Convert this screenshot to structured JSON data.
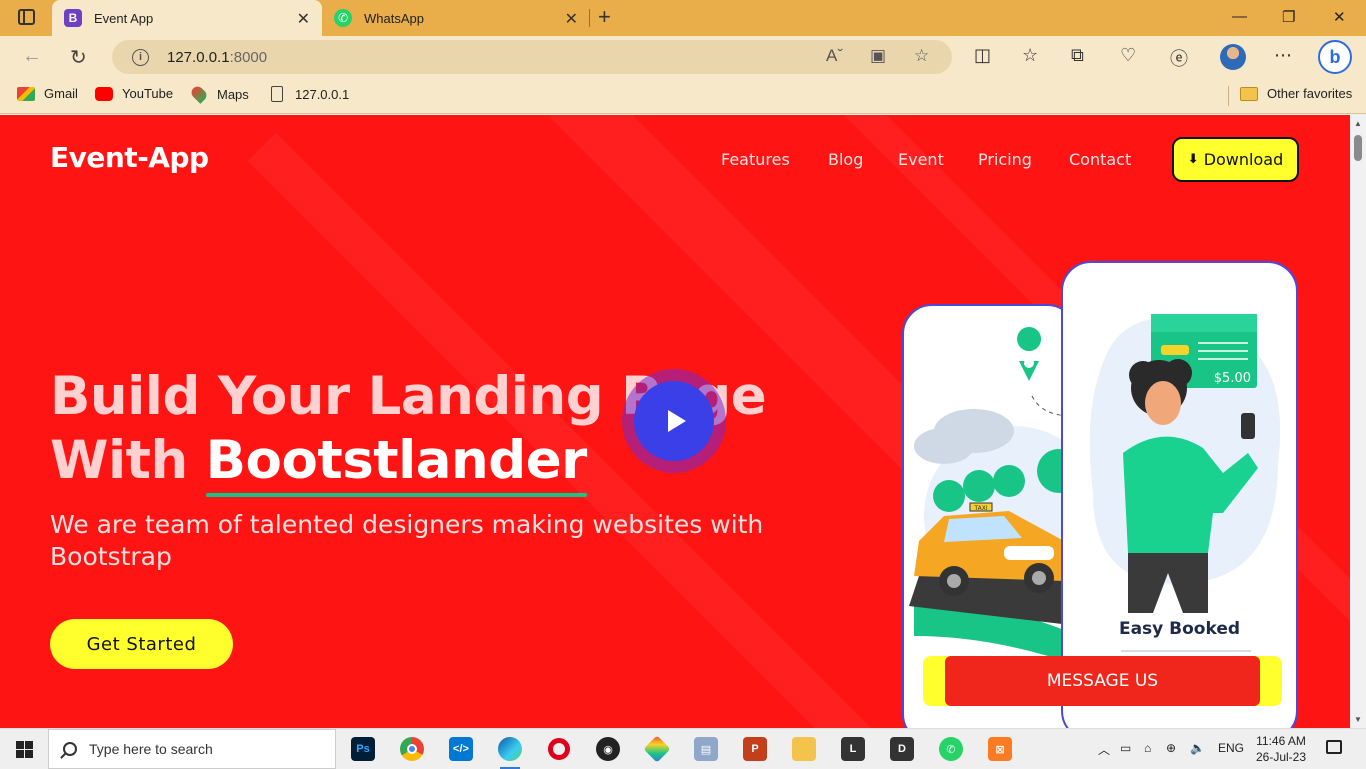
{
  "browser": {
    "tabs": [
      {
        "title": "Event App",
        "icon": "bootstrap-icon",
        "active": true
      },
      {
        "title": "WhatsApp",
        "icon": "whatsapp-icon",
        "active": false
      }
    ],
    "address": {
      "host": "127.0.0.1",
      "port": ":8000"
    },
    "bookmarks": [
      {
        "label": "Gmail",
        "icon": "gmail-icon"
      },
      {
        "label": "YouTube",
        "icon": "youtube-icon"
      },
      {
        "label": "Maps",
        "icon": "maps-icon"
      },
      {
        "label": "127.0.0.1",
        "icon": "page-icon"
      }
    ],
    "other_favorites": "Other favorites"
  },
  "site": {
    "brand": "Event-App",
    "menu": [
      "Features",
      "Blog",
      "Event",
      "Pricing",
      "Contact"
    ],
    "download_label": "Download",
    "hero": {
      "title_line1": "Build Your Landing Page",
      "title_line2_prefix": "With ",
      "title_highlight": "Bootstlander",
      "subtitle": "We are team of talented designers making websites with Bootstrap",
      "cta": "Get Started"
    },
    "phone": {
      "price": "$5.00",
      "caption": "Easy Booked",
      "taxi_sign": "TAXI"
    },
    "message_button": "MESSAGE US",
    "colors": {
      "background": "#ff1414",
      "accent_yellow": "#ffff2e",
      "play": "#3b3fe8",
      "underline": "#19c586"
    }
  },
  "taskbar": {
    "search_placeholder": "Type here to search",
    "apps": [
      "Photoshop",
      "Chrome",
      "VS Code",
      "Edge",
      "Opera",
      "OBS",
      "Git",
      "Network",
      "PowerPoint",
      "File Explorer",
      "L",
      "D",
      "WhatsApp",
      "XAMPP"
    ],
    "language": "ENG",
    "time": "11:46 AM",
    "date": "26-Jul-23"
  }
}
